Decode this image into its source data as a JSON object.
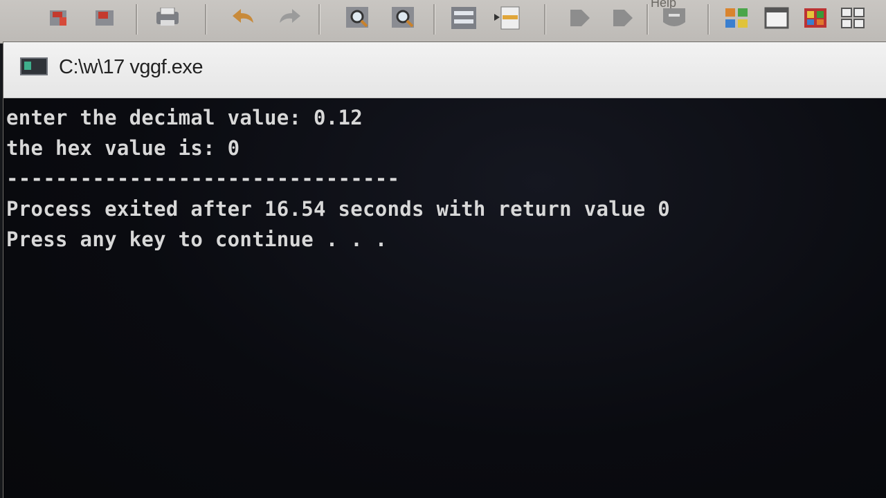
{
  "ide": {
    "menu_hint": "Help",
    "toolbar_icons": [
      "save-all-icon",
      "close-file-icon",
      "print-icon",
      "undo-icon",
      "redo-icon",
      "find-icon",
      "replace-icon",
      "indent-icon",
      "unindent-icon",
      "bookmark-icon",
      "goto-icon",
      "compile-icon",
      "new-project-icon",
      "window-icon",
      "class-browser-icon",
      "layout-icon"
    ]
  },
  "console": {
    "window_title": "C:\\w\\17 vggf.exe",
    "lines": [
      "enter the decimal value: 0.12",
      "the hex value is: 0",
      "--------------------------------",
      "Process exited after 16.54 seconds with return value 0",
      "Press any key to continue . . ."
    ]
  },
  "colors": {
    "console_background": "#0a0b10",
    "console_text": "#d8d8d8",
    "title_bar": "#eeeeee",
    "toolbar": "#c6c3bf"
  }
}
